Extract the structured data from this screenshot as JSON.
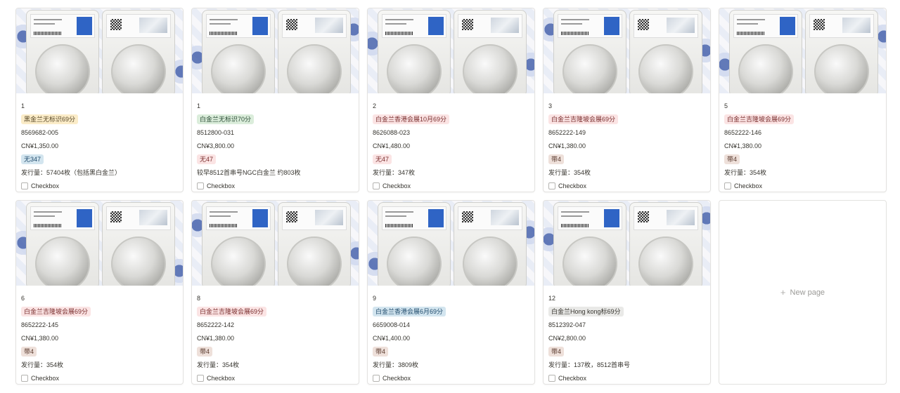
{
  "cards": [
    {
      "number": "1",
      "tag": "黑金兰无标识69分",
      "tag_color": "yellow",
      "cert": "8569682-005",
      "price": "CN¥1,350.00",
      "badge": "无347",
      "badge_color": "blue",
      "mintage": "发行量：57404枚（包括黑白金兰）",
      "checkbox_label": "Checkbox"
    },
    {
      "number": "1",
      "tag": "白金兰无标识70分",
      "tag_color": "green",
      "cert": "8512800-031",
      "price": "CN¥3,800.00",
      "badge": "无47",
      "badge_color": "red",
      "mintage": "较早8512首串号NGC白金兰 约803枚",
      "checkbox_label": "Checkbox"
    },
    {
      "number": "2",
      "tag": "白金兰香港会展10月69分",
      "tag_color": "red",
      "cert": "8626088-023",
      "price": "CN¥1,480.00",
      "badge": "无47",
      "badge_color": "red",
      "mintage": "发行量：347枚",
      "checkbox_label": "Checkbox"
    },
    {
      "number": "3",
      "tag": "白金兰吉隆坡会展69分",
      "tag_color": "red",
      "cert": "8652222-149",
      "price": "CN¥1,380.00",
      "badge": "带4",
      "badge_color": "brown",
      "mintage": "发行量：354枚",
      "checkbox_label": "Checkbox"
    },
    {
      "number": "5",
      "tag": "白金兰吉隆坡会展69分",
      "tag_color": "red",
      "cert": "8652222-146",
      "price": "CN¥1,380.00",
      "badge": "带4",
      "badge_color": "brown",
      "mintage": "发行量：354枚",
      "checkbox_label": "Checkbox"
    },
    {
      "number": "6",
      "tag": "白金兰吉隆坡会展69分",
      "tag_color": "red",
      "cert": "8652222-145",
      "price": "CN¥1,380.00",
      "badge": "带4",
      "badge_color": "brown",
      "mintage": "发行量：354枚",
      "checkbox_label": "Checkbox"
    },
    {
      "number": "8",
      "tag": "白金兰吉隆坡会展69分",
      "tag_color": "red",
      "cert": "8652222-142",
      "price": "CN¥1,380.00",
      "badge": "带4",
      "badge_color": "brown",
      "mintage": "发行量：354枚",
      "checkbox_label": "Checkbox"
    },
    {
      "number": "9",
      "tag": "白金兰香港会展6月69分",
      "tag_color": "blue",
      "cert": "6659008-014",
      "price": "CN¥1,400.00",
      "badge": "带4",
      "badge_color": "brown",
      "mintage": "发行量：3809枚",
      "checkbox_label": "Checkbox"
    },
    {
      "number": "12",
      "tag": "白金兰Hong kong标69分",
      "tag_color": "gray",
      "cert": "8512392-047",
      "price": "CN¥2,800.00",
      "badge": "带4",
      "badge_color": "brown",
      "mintage": "发行量：137枚，8512首串号",
      "checkbox_label": "Checkbox"
    }
  ],
  "new_page": {
    "label": "New page",
    "icon": "plus-icon"
  }
}
